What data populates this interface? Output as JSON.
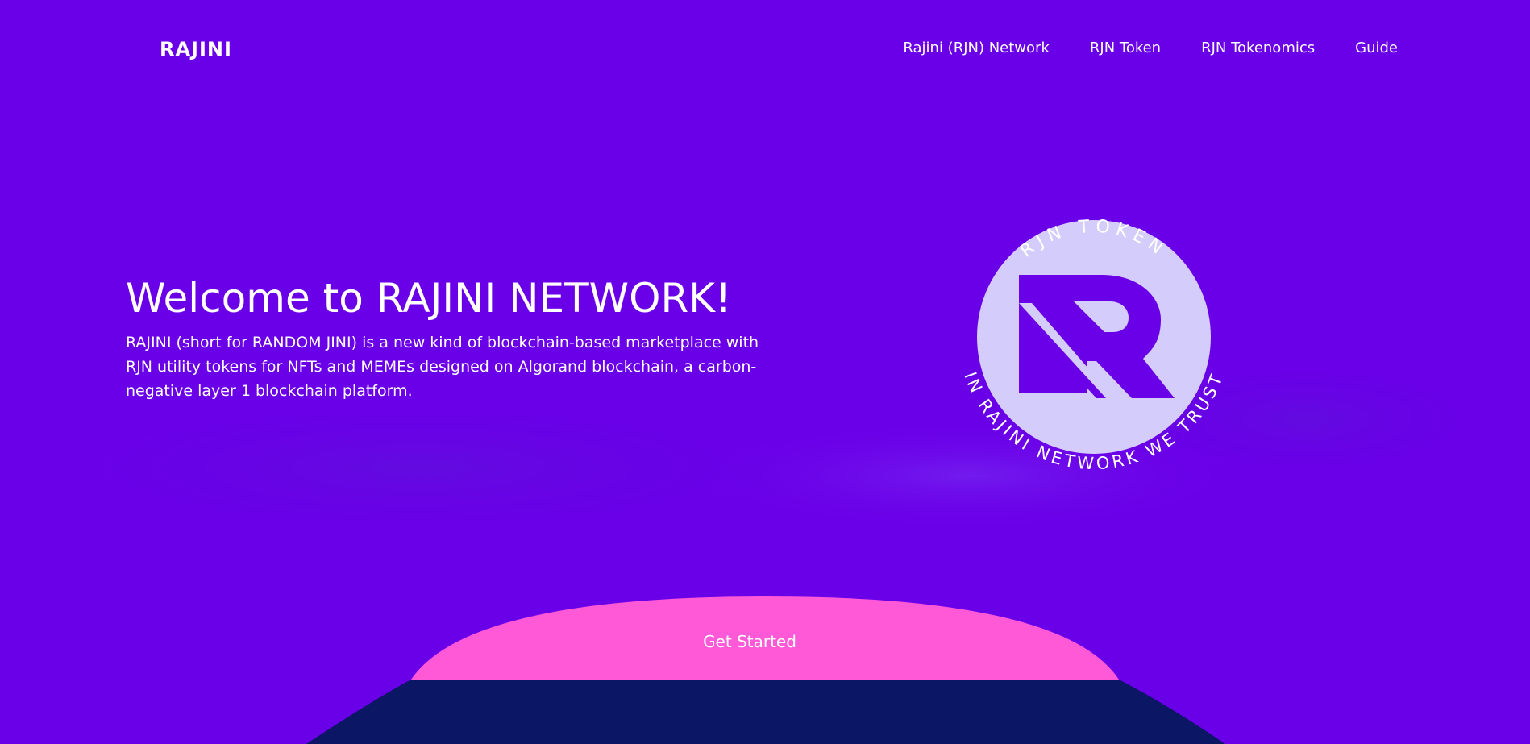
{
  "header": {
    "logo_text": "RAJINI",
    "nav": [
      {
        "label": "Rajini (RJN) Network"
      },
      {
        "label": "RJN Token"
      },
      {
        "label": "RJN Tokenomics"
      },
      {
        "label": "Guide"
      }
    ]
  },
  "hero": {
    "title": "Welcome to RAJINI NETWORK!",
    "description": "RAJINI (short for RANDOM JINI) is a new kind of blockchain-based marketplace with RJN utility tokens for NFTs and MEMEs designed on Algorand blockchain, a carbon-negative layer 1 blockchain platform."
  },
  "badge": {
    "top_text": "RJN TOKEN",
    "bottom_text": "IN RAJINI NETWORK WE TRUST",
    "icon": "rajini-r-logo-icon"
  },
  "cta": {
    "label": "Get Started"
  },
  "colors": {
    "background": "#6a00e8",
    "badge_circle": "#d4ccfb",
    "cta_pink": "#ff59d8",
    "footer_navy": "#0b1664",
    "text": "#ffffff"
  }
}
